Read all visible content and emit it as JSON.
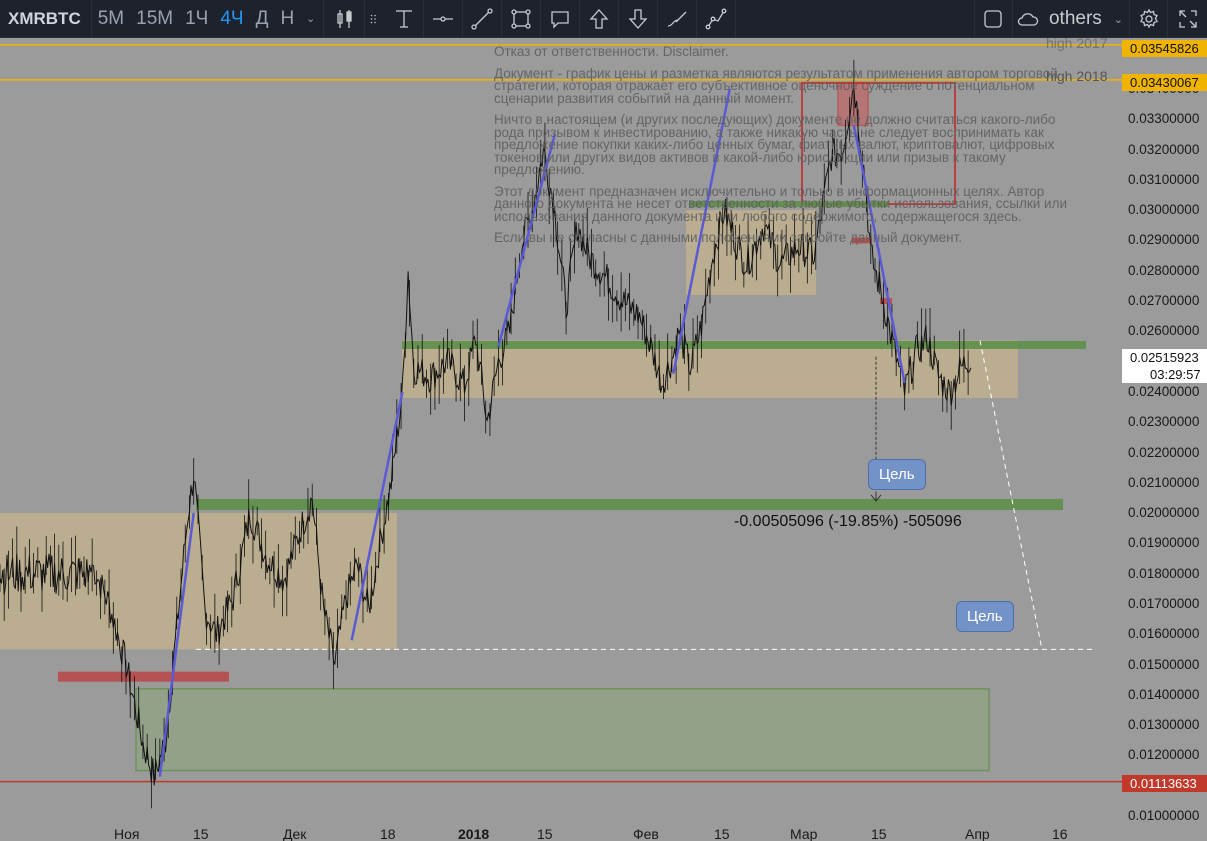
{
  "toolbar": {
    "symbol": "XMRBTC",
    "intervals": [
      {
        "label": "5М",
        "active": false
      },
      {
        "label": "15М",
        "active": false
      },
      {
        "label": "1Ч",
        "active": false
      },
      {
        "label": "4Ч",
        "active": true
      },
      {
        "label": "Д",
        "active": false
      },
      {
        "label": "Н",
        "active": false
      }
    ],
    "chart_type_icon": "candles-icon",
    "tools": [
      "cross-cursor-icon",
      "text-cursor-icon",
      "horizontal-line-icon",
      "trend-line-icon",
      "rectangle-icon",
      "callout-icon",
      "arrow-up-icon",
      "arrow-down-icon",
      "brush-icon",
      "path-icon"
    ],
    "others_label": "others",
    "right_icons": [
      "square-icon",
      "cloud-icon",
      "settings-icon",
      "fullscreen-icon"
    ]
  },
  "disclaimer": [
    "Отказ от ответственности. Disclaimer.",
    "Документ - график цены и разметка являются результатом применения автором торговой стратегии, которая отражает его субъективное оценочное суждение о потенциальном сценарии развития событий на данный момент.",
    "Ничто в настоящем (и других последующих) документе не должно считаться какого-либо рода призывом к инвестированию, а также никакую часть не следует воспринимать как предложение покупки каких-либо ценных бумаг, фиатных валют, криптовалют, цифровых токенов или других видов активов в какой-либо юрисдикции или призыв к такому предложению.",
    "Этот документ предназначен исключительно и только в информационных целях. Автор данного документа не несет ответственности за любые убытки использования, ссылки или использования данного документа или любого содержимого, содержащегося здесь.",
    "Если вы не согласны с данными положениями закройте данный документ."
  ],
  "annotations": {
    "high_label": "high 2018",
    "high_label_top": "high 2017",
    "target1": "Цель",
    "target2": "Цель",
    "measure": "-0.00505096 (-19.85%) -505096"
  },
  "price_badges": {
    "top": "0.03545826",
    "high": "0.03430067",
    "current": "0.02515923",
    "countdown": "03:29:57",
    "low": "0.01113633"
  },
  "colors": {
    "toolbar_bg": "#1e222d",
    "chart_bg": "#9b9b9b",
    "accent_blue": "#2196f3",
    "trend_blue": "#5a5ad6",
    "zone_tan": "#c6b48c",
    "zone_green": "#5e8f4a",
    "zone_red": "#b84a4a",
    "low_line": "#c0392b",
    "high_line": "#f0b400"
  },
  "chart_data": {
    "type": "candlestick",
    "symbol": "XMRBTC",
    "interval": "4Ч",
    "y_axis": {
      "min": 0.01,
      "max": 0.036,
      "ticks": [
        "0.03400000",
        "0.03300000",
        "0.03200000",
        "0.03100000",
        "0.03000000",
        "0.02900000",
        "0.02800000",
        "0.02700000",
        "0.02600000",
        "0.02400000",
        "0.02300000",
        "0.02200000",
        "0.02100000",
        "0.02000000",
        "0.01900000",
        "0.01800000",
        "0.01700000",
        "0.01600000",
        "0.01500000",
        "0.01400000",
        "0.01300000",
        "0.01200000",
        "0.01000000"
      ]
    },
    "x_axis": {
      "ticks": [
        "Ноя",
        "15",
        "Дек",
        "18",
        "2018",
        "15",
        "Фев",
        "15",
        "Мар",
        "15",
        "Апр",
        "16"
      ]
    },
    "path": [
      [
        "2017-10-26",
        0.0183
      ],
      [
        "2017-10-29",
        0.017
      ],
      [
        "2017-11-01",
        0.015
      ],
      [
        "2017-11-04",
        0.0124
      ],
      [
        "2017-11-06",
        0.0113
      ],
      [
        "2017-11-08",
        0.0125
      ],
      [
        "2017-11-10",
        0.0162
      ],
      [
        "2017-11-12",
        0.02
      ],
      [
        "2017-11-13",
        0.0213
      ],
      [
        "2017-11-15",
        0.0168
      ],
      [
        "2017-11-17",
        0.016
      ],
      [
        "2017-11-20",
        0.0172
      ],
      [
        "2017-11-23",
        0.02
      ],
      [
        "2017-11-26",
        0.0185
      ],
      [
        "2017-11-29",
        0.0178
      ],
      [
        "2017-12-02",
        0.0195
      ],
      [
        "2017-12-04",
        0.0205
      ],
      [
        "2017-12-06",
        0.0168
      ],
      [
        "2017-12-08",
        0.015
      ],
      [
        "2017-12-10",
        0.0172
      ],
      [
        "2017-12-12",
        0.0183
      ],
      [
        "2017-12-14",
        0.0168
      ],
      [
        "2017-12-16",
        0.019
      ],
      [
        "2017-12-18",
        0.021
      ],
      [
        "2017-12-20",
        0.024
      ],
      [
        "2017-12-21",
        0.028
      ],
      [
        "2017-12-22",
        0.0248
      ],
      [
        "2017-12-25",
        0.0245
      ],
      [
        "2017-12-28",
        0.025
      ],
      [
        "2017-12-31",
        0.0242
      ],
      [
        "2018-01-02",
        0.0258
      ],
      [
        "2018-01-04",
        0.023
      ],
      [
        "2018-01-06",
        0.025
      ],
      [
        "2018-01-08",
        0.026
      ],
      [
        "2018-01-10",
        0.0288
      ],
      [
        "2018-01-12",
        0.03
      ],
      [
        "2018-01-14",
        0.032
      ],
      [
        "2018-01-16",
        0.03
      ],
      [
        "2018-01-18",
        0.0268
      ],
      [
        "2018-01-20",
        0.0295
      ],
      [
        "2018-01-22",
        0.0285
      ],
      [
        "2018-01-25",
        0.0278
      ],
      [
        "2018-01-28",
        0.027
      ],
      [
        "2018-01-31",
        0.0265
      ],
      [
        "2018-02-02",
        0.0255
      ],
      [
        "2018-02-04",
        0.0243
      ],
      [
        "2018-02-06",
        0.0252
      ],
      [
        "2018-02-07",
        0.026
      ],
      [
        "2018-02-09",
        0.0248
      ],
      [
        "2018-02-11",
        0.0262
      ],
      [
        "2018-02-13",
        0.0285
      ],
      [
        "2018-02-15",
        0.03
      ],
      [
        "2018-02-17",
        0.029
      ],
      [
        "2018-02-19",
        0.0282
      ],
      [
        "2018-02-22",
        0.0295
      ],
      [
        "2018-02-25",
        0.0282
      ],
      [
        "2018-02-28",
        0.0288
      ],
      [
        "2018-03-03",
        0.0285
      ],
      [
        "2018-03-06",
        0.0318
      ],
      [
        "2018-03-08",
        0.032
      ],
      [
        "2018-03-10",
        0.0342
      ],
      [
        "2018-03-12",
        0.031
      ],
      [
        "2018-03-13",
        0.0285
      ],
      [
        "2018-03-15",
        0.0272
      ],
      [
        "2018-03-17",
        0.0255
      ],
      [
        "2018-03-19",
        0.024
      ],
      [
        "2018-03-21",
        0.0253
      ],
      [
        "2018-03-23",
        0.0258
      ],
      [
        "2018-03-25",
        0.0245
      ],
      [
        "2018-03-27",
        0.024
      ],
      [
        "2018-03-29",
        0.0248
      ],
      [
        "2018-03-31",
        0.0252
      ]
    ],
    "horizontal_levels": {
      "high_2017": 0.03545826,
      "high_2018": 0.03430067,
      "current": 0.02515923,
      "low": 0.01113633,
      "target_dashed": 0.0155
    },
    "zones": [
      {
        "kind": "tan",
        "y": [
          0.0155,
          0.02
        ]
      },
      {
        "kind": "tan",
        "y": [
          0.0238,
          0.0257
        ]
      },
      {
        "kind": "tan",
        "y": [
          0.0272,
          0.03
        ]
      },
      {
        "kind": "green-box",
        "y": [
          0.0115,
          0.0142
        ]
      },
      {
        "kind": "red-box",
        "y": [
          0.0302,
          0.0342
        ]
      }
    ],
    "grid": false,
    "legend": "none"
  }
}
